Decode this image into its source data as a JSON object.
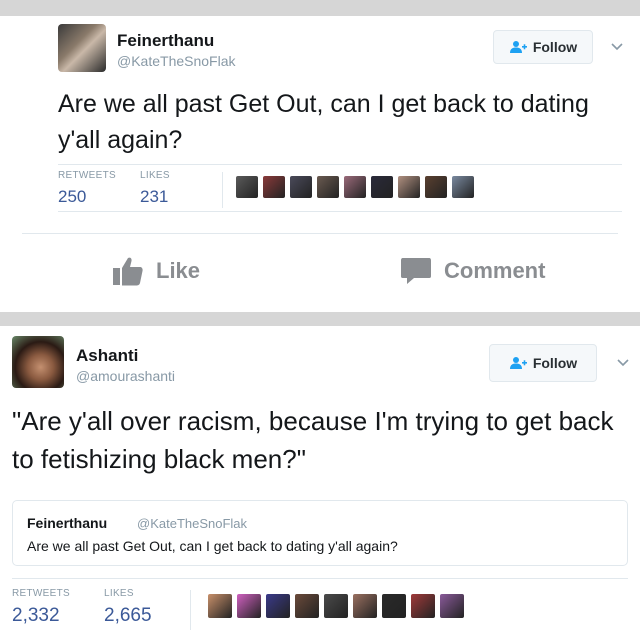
{
  "tweet1": {
    "name": "Feinerthanu",
    "handle": "@KateTheSnoFlak",
    "follow_label": "Follow",
    "text": "Are we all past Get Out, can I get back to dating y'all again?",
    "retweets_label": "RETWEETS",
    "retweets": "250",
    "likes_label": "LIKES",
    "likes": "231",
    "liker_colors": [
      "#5a5a5a",
      "#8a3a3a",
      "#4a4a5a",
      "#6a5a50",
      "#9a6a7a",
      "#2a2a3a",
      "#b09080",
      "#5a4030",
      "#7a8aa0"
    ]
  },
  "facebook_actions": {
    "like_label": "Like",
    "comment_label": "Comment"
  },
  "tweet2": {
    "name": "Ashanti",
    "handle": "@amourashanti",
    "follow_label": "Follow",
    "text": "\"Are y'all over racism, because I'm trying to get back to fetishizing black men?\"",
    "quoted": {
      "name": "Feinerthanu",
      "handle": "@KateTheSnoFlak",
      "text": "Are we all past Get Out, can I get back to dating y'all again?"
    },
    "retweets_label": "RETWEETS",
    "retweets": "2,332",
    "likes_label": "LIKES",
    "likes": "2,665",
    "liker_colors": [
      "#c8906a",
      "#d060c0",
      "#3a3a8a",
      "#6a4a3a",
      "#4a4a4a",
      "#9a7060",
      "#2a2a2a",
      "#a03a3a",
      "#8a5a9a"
    ]
  },
  "colors": {
    "link_blue": "#3b5998",
    "muted_gray": "#8899a6",
    "fb_gray": "#8a8d91"
  }
}
